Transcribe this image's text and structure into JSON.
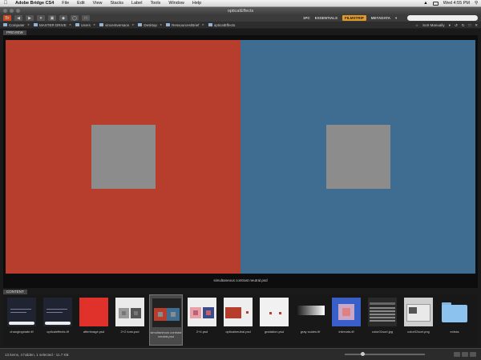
{
  "menubar": {
    "app_name": "Adobe Bridge CS4",
    "items": [
      "File",
      "Edit",
      "View",
      "Stacks",
      "Label",
      "Tools",
      "Window",
      "Help"
    ],
    "status_text": "Wed 4:55 PM"
  },
  "window": {
    "title": "opticalEffects"
  },
  "toolbar": {
    "workspaces": [
      "1PC",
      "ESSENTIALS",
      "FILMSTRIP",
      "METADATA"
    ],
    "active_workspace": "FILMSTRIP",
    "search_placeholder": ""
  },
  "path": {
    "crumbs": [
      "Computer",
      "MASTER DRIVE",
      "Users",
      "vincentversace",
      "Desktop",
      "Ressources/Brief",
      "opticalEffects"
    ],
    "sort_label": "Sort Manually"
  },
  "preview": {
    "tab_label": "PREVIEW",
    "caption": "simultaneous contrast neutral.psd",
    "colors": {
      "red": "#b73d2c",
      "blue": "#3f6c91",
      "gray": "#8c8c8c"
    }
  },
  "content": {
    "tab_label": "CONTENT",
    "items": [
      {
        "label": "changingstate.tif",
        "kind": "dark-text"
      },
      {
        "label": "opticaleffects.tif",
        "kind": "dark-text"
      },
      {
        "label": "afterimage.psd",
        "kind": "red"
      },
      {
        "label": "2+2 tons.psd",
        "kind": "grays"
      },
      {
        "label": "simultaneous contrast neutral.psd",
        "kind": "selected"
      },
      {
        "label": "2+4.psd",
        "kind": "pinkblue"
      },
      {
        "label": "opticalneutral.psd",
        "kind": "redwhite"
      },
      {
        "label": "gradation.psd",
        "kind": "white-red"
      },
      {
        "label": "gray scales.tif",
        "kind": "grayscale"
      },
      {
        "label": "intervals.tif",
        "kind": "blue-pink"
      },
      {
        "label": "color01sort.jpg",
        "kind": "screen-dark"
      },
      {
        "label": "color02sort.png",
        "kind": "screen-light"
      },
      {
        "label": "extras",
        "kind": "folder"
      }
    ]
  },
  "statusbar": {
    "text": "13 items, 4 hidden, 1 selected - 11.7 KB"
  }
}
